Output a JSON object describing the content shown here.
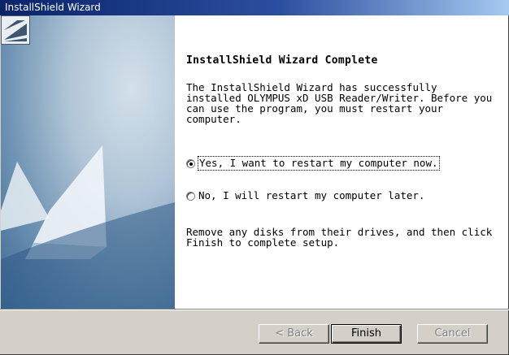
{
  "window": {
    "title": "InstallShield Wizard"
  },
  "content": {
    "heading": "InstallShield Wizard Complete",
    "intro": "The InstallShield Wizard has successfully installed OLYMPUS xD USB Reader/Writer.  Before you can use the program, you must restart your computer.",
    "options": [
      {
        "label": "Yes, I want to restart my computer now.",
        "selected": true
      },
      {
        "label": "No, I will restart my computer later.",
        "selected": false
      }
    ],
    "footer_note": "Remove any disks from their drives, and then click Finish to complete setup."
  },
  "buttons": {
    "back": "< Back",
    "finish": "Finish",
    "cancel": "Cancel"
  },
  "icons": {
    "wizard_logo": "installshield-logo-icon",
    "side_art": "sail-graphic-icon"
  }
}
